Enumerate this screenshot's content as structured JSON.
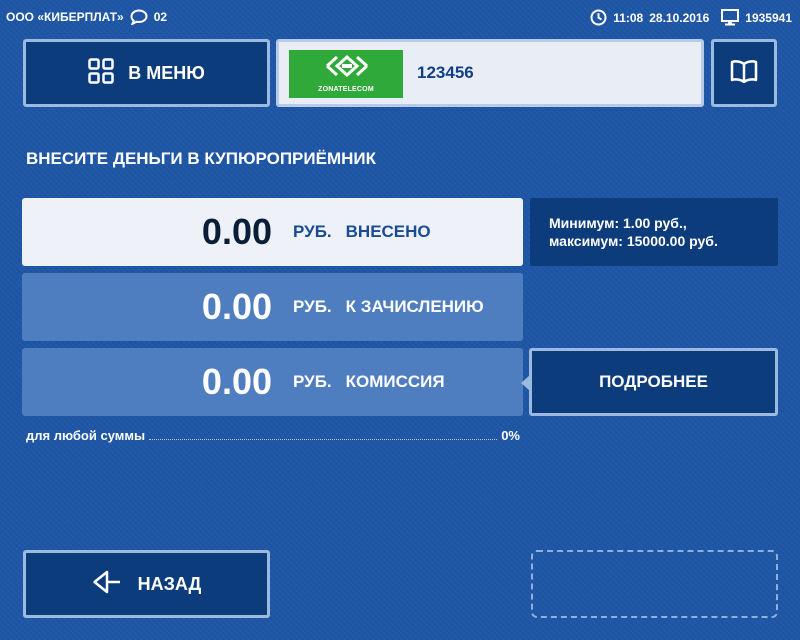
{
  "status": {
    "company": "ООО «КИБЕРПЛАТ»",
    "messages_count": "02",
    "time": "11:08",
    "date": "28.10.2016",
    "terminal_id": "1935941"
  },
  "menu_button": {
    "label": "В МЕНЮ",
    "icon": "grid-icon"
  },
  "provider": {
    "logo_text": "ZONATELECOM",
    "logo_color": "#2faa3a",
    "account": "123456"
  },
  "book_button": {
    "icon": "book-icon"
  },
  "prompt": "ВНЕСИТЕ ДЕНЬГИ В КУПЮРОПРИЁМНИК",
  "rows": [
    {
      "amount": "0.00",
      "currency": "РУБ.",
      "label": "ВНЕСЕНО"
    },
    {
      "amount": "0.00",
      "currency": "РУБ.",
      "label": "К ЗАЧИСЛЕНИЮ"
    },
    {
      "amount": "0.00",
      "currency": "РУБ.",
      "label": "КОМИССИЯ"
    }
  ],
  "limits": {
    "min": "Минимум: 1.00 руб.,",
    "max": "максимум: 15000.00 руб."
  },
  "details_button": {
    "label": "ПОДРОБНЕЕ"
  },
  "fee_info": {
    "label": "для любой суммы",
    "value": "0%"
  },
  "back_button": {
    "label": "НАЗАД",
    "icon": "back-arrow-icon"
  },
  "colors": {
    "background": "#1e56a6",
    "button": "#0d3c7c",
    "row_active": "#eef2f8",
    "row_inactive": "#4f7ec0"
  }
}
